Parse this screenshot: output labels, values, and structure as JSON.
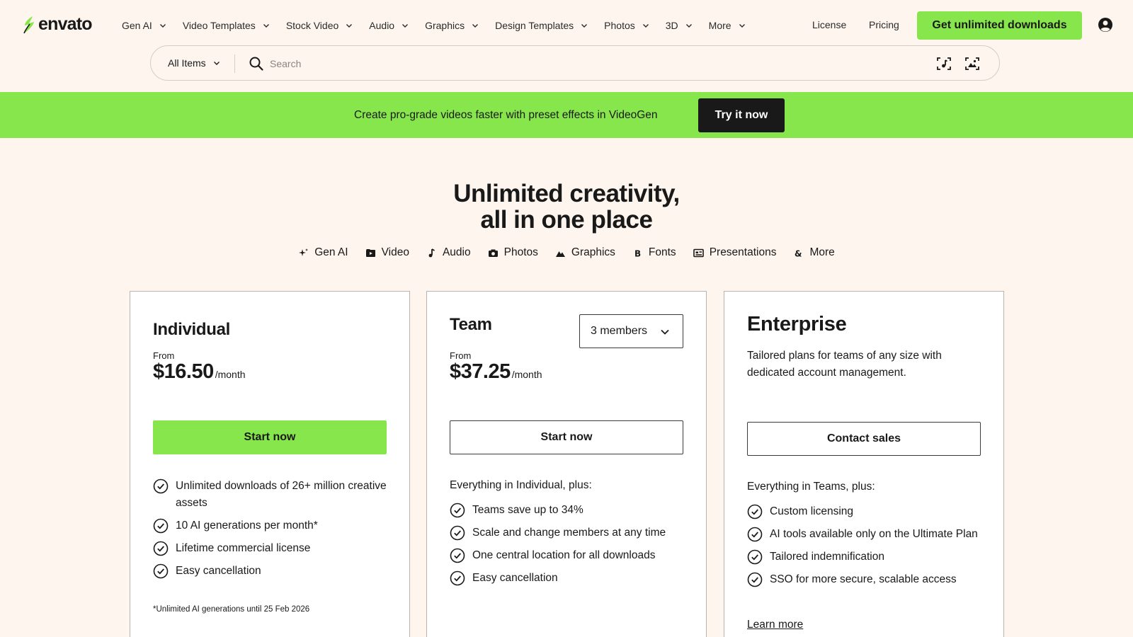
{
  "brand": {
    "name": "envato",
    "accent": "#87e64b"
  },
  "nav": {
    "items": [
      {
        "label": "Gen AI"
      },
      {
        "label": "Video Templates"
      },
      {
        "label": "Stock Video"
      },
      {
        "label": "Audio"
      },
      {
        "label": "Graphics"
      },
      {
        "label": "Design Templates"
      },
      {
        "label": "Photos"
      },
      {
        "label": "3D"
      },
      {
        "label": "More"
      }
    ],
    "license": "License",
    "pricing": "Pricing",
    "cta": "Get unlimited downloads",
    "account_icon": "account-icon"
  },
  "search": {
    "category": "All Items",
    "placeholder": "Search",
    "value": ""
  },
  "promo": {
    "text": "Create pro-grade videos faster with preset effects in VideoGen",
    "button": "Try it now"
  },
  "hero": {
    "line1": "Unlimited creativity,",
    "line2": "all in one place",
    "categories": [
      {
        "label": "Gen AI",
        "icon": "sparkle-icon"
      },
      {
        "label": "Video",
        "icon": "video-icon"
      },
      {
        "label": "Audio",
        "icon": "music-note-icon"
      },
      {
        "label": "Photos",
        "icon": "camera-icon"
      },
      {
        "label": "Graphics",
        "icon": "mountain-icon"
      },
      {
        "label": "Fonts",
        "icon": "font-icon"
      },
      {
        "label": "Presentations",
        "icon": "presentation-icon"
      },
      {
        "label": "More",
        "icon": "ampersand-icon"
      }
    ]
  },
  "plans": {
    "individual": {
      "name": "Individual",
      "from": "From",
      "price": "$16.50",
      "unit": "/month",
      "button": "Start now",
      "features": [
        "Unlimited downloads of 26+ million creative assets",
        "10 AI generations per month*",
        "Lifetime commercial license",
        "Easy cancellation"
      ],
      "footnote": "*Unlimited AI generations until 25 Feb 2026"
    },
    "team": {
      "name": "Team",
      "members": "3 members",
      "from": "From",
      "price": "$37.25",
      "unit": "/month",
      "button": "Start now",
      "plus": "Everything in Individual, plus:",
      "features": [
        "Teams save up to 34%",
        "Scale and change members at any time",
        "One central location for all downloads",
        "Easy cancellation"
      ]
    },
    "enterprise": {
      "name": "Enterprise",
      "description": "Tailored plans for teams of any size with dedicated account management.",
      "button": "Contact sales",
      "plus": "Everything in Teams, plus:",
      "features": [
        "Custom licensing",
        "AI tools available only on the Ultimate Plan",
        "Tailored indemnification",
        "SSO for more secure, scalable access"
      ],
      "learn_more": "Learn more"
    }
  }
}
